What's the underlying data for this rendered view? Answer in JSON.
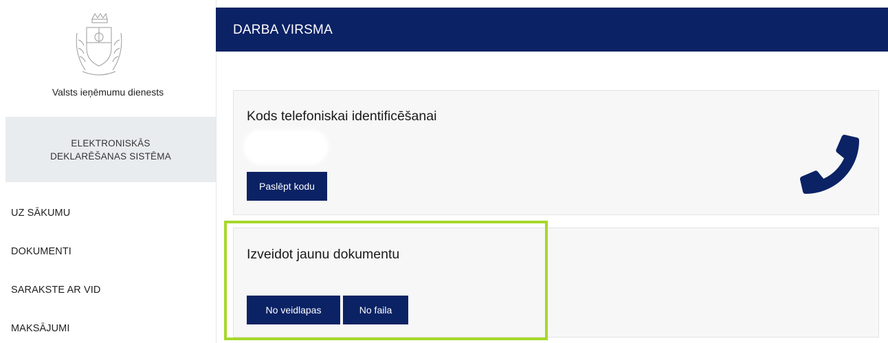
{
  "sidebar": {
    "org_name": "Valsts ieņēmumu dienests",
    "system_line1": "ELEKTRONISKĀS",
    "system_line2": "DEKLARĒŠANAS SISTĒMA",
    "nav": [
      {
        "label": "UZ SĀKUMU"
      },
      {
        "label": "DOKUMENTI"
      },
      {
        "label": "SARAKSTE AR VID"
      },
      {
        "label": "MAKSĀJUMI"
      }
    ]
  },
  "header": {
    "title": "DARBA VIRSMA"
  },
  "phone_card": {
    "title": "Kods telefoniskai identificēšanai",
    "hide_button": "Paslēpt kodu",
    "icon": "phone-icon"
  },
  "new_doc_card": {
    "title": "Izveidot jaunu dokumentu",
    "from_template_button": "No veidlapas",
    "from_file_button": "No faila"
  },
  "colors": {
    "brand_navy": "#0b2265",
    "highlight_green": "#a6d82a",
    "card_bg": "#f7f7f7",
    "sidebar_block_bg": "#e9ecef"
  }
}
